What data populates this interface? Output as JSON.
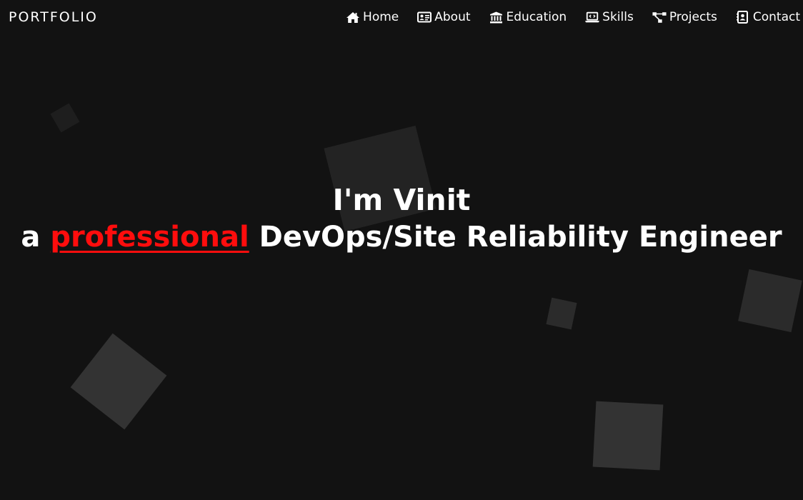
{
  "nav": {
    "brand": "PORTFOLIO",
    "links": [
      {
        "label": "Home",
        "icon": "home-icon"
      },
      {
        "label": "About",
        "icon": "id-card-icon"
      },
      {
        "label": "Education",
        "icon": "university-icon"
      },
      {
        "label": "Skills",
        "icon": "laptop-code-icon"
      },
      {
        "label": "Projects",
        "icon": "project-diagram-icon"
      },
      {
        "label": "Contact",
        "icon": "address-book-icon"
      }
    ]
  },
  "hero": {
    "greeting": "I'm Vinit",
    "prefix": "a",
    "highlight": "professional",
    "role": "DevOps/Site Reliability Engineer"
  },
  "colors": {
    "background": "#121212",
    "accent": "#ff0d0d",
    "text": "#ffffff",
    "shape": "#2a2a2a"
  }
}
